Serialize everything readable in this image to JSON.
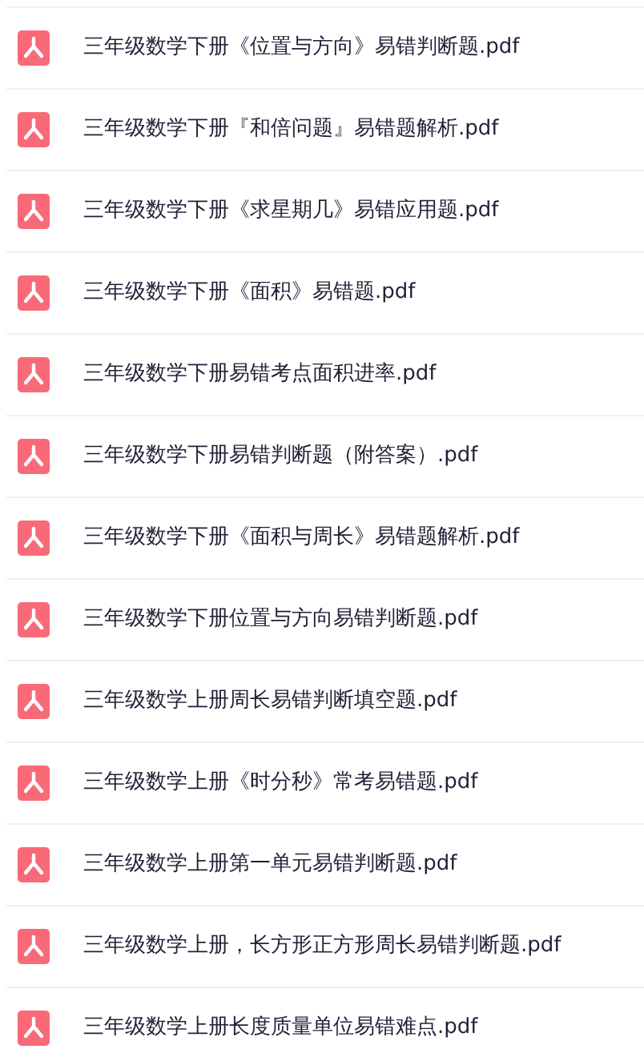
{
  "files": [
    {
      "name": "三年级数学下册《位置与方向》易错判断题.pdf",
      "kind": "pdf"
    },
    {
      "name": "三年级数学下册『和倍问题』易错题解析.pdf",
      "kind": "pdf"
    },
    {
      "name": "三年级数学下册《求星期几》易错应用题.pdf",
      "kind": "pdf"
    },
    {
      "name": "三年级数学下册《面积》易错题.pdf",
      "kind": "pdf"
    },
    {
      "name": "三年级数学下册易错考点面积进率.pdf",
      "kind": "pdf"
    },
    {
      "name": "三年级数学下册易错判断题（附答案）.pdf",
      "kind": "pdf"
    },
    {
      "name": "三年级数学下册《面积与周长》易错题解析.pdf",
      "kind": "pdf"
    },
    {
      "name": "三年级数学下册位置与方向易错判断题.pdf",
      "kind": "pdf"
    },
    {
      "name": "三年级数学上册周长易错判断填空题.pdf",
      "kind": "pdf"
    },
    {
      "name": "三年级数学上册《时分秒》常考易错题.pdf",
      "kind": "pdf"
    },
    {
      "name": "三年级数学上册第一单元易错判断题.pdf",
      "kind": "pdf"
    },
    {
      "name": "三年级数学上册，长方形正方形周长易错判断题.pdf",
      "kind": "pdf"
    },
    {
      "name": "三年级数学上册长度质量单位易错难点.pdf",
      "kind": "pdf"
    }
  ]
}
